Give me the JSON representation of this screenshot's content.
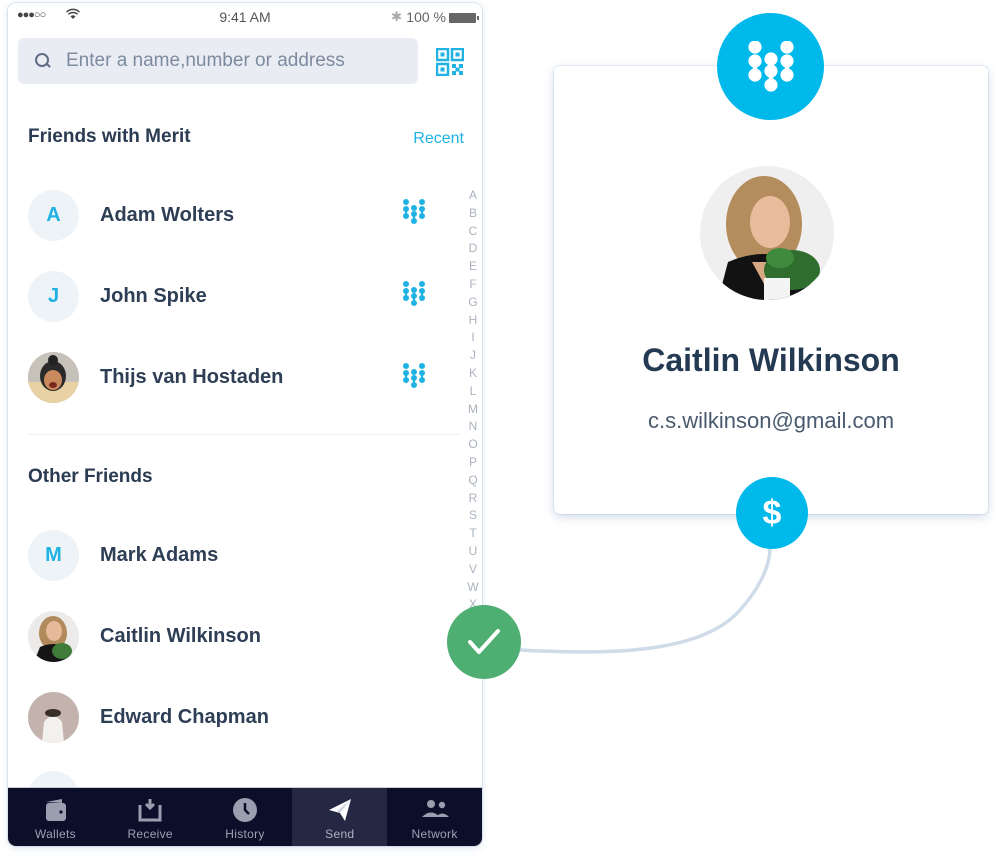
{
  "status_bar": {
    "signal": "●●●○○",
    "time": "9:41 AM",
    "bluetooth": "✱",
    "battery_percent": "100 %"
  },
  "search": {
    "placeholder": "Enter a name,number or address",
    "value": ""
  },
  "icons": {
    "search": "search-icon",
    "qr": "qr-code-icon",
    "merit": "merit-logo-icon",
    "dollar": "dollar-icon",
    "check": "checkmark-icon"
  },
  "sections": {
    "merit_friends": {
      "title": "Friends with Merit",
      "action": "Recent",
      "contacts": [
        {
          "name": "Adam Wolters",
          "initial": "A",
          "avatar": "initial"
        },
        {
          "name": "John Spike",
          "initial": "J",
          "avatar": "initial"
        },
        {
          "name": "Thijs van Hostaden",
          "initial": "",
          "avatar": "photo"
        }
      ]
    },
    "other_friends": {
      "title": "Other Friends",
      "contacts": [
        {
          "name": "Mark Adams",
          "initial": "M",
          "avatar": "initial"
        },
        {
          "name": "Caitlin Wilkinson",
          "initial": "",
          "avatar": "photo"
        },
        {
          "name": "Edward Chapman",
          "initial": "",
          "avatar": "photo"
        }
      ]
    }
  },
  "index_letters": [
    "A",
    "B",
    "C",
    "D",
    "E",
    "F",
    "G",
    "H",
    "I",
    "J",
    "K",
    "L",
    "M",
    "N",
    "O",
    "P",
    "Q",
    "R",
    "S",
    "T",
    "U",
    "V",
    "W",
    "X"
  ],
  "tabbar": {
    "active": "Send",
    "tabs": [
      {
        "label": "Wallets",
        "icon": "wallet-icon"
      },
      {
        "label": "Receive",
        "icon": "receive-icon"
      },
      {
        "label": "History",
        "icon": "history-clock-icon"
      },
      {
        "label": "Send",
        "icon": "send-paper-plane-icon"
      },
      {
        "label": "Network",
        "icon": "network-people-icon"
      }
    ]
  },
  "profile_card": {
    "name": "Caitlin Wilkinson",
    "email": "c.s.wilkinson@gmail.com",
    "action_symbol": "$"
  },
  "colors": {
    "accent": "#00b9eb",
    "success": "#4fae71",
    "tabbar_bg": "#0c0f29",
    "tabbar_active": "#252842",
    "text_primary": "#2a3b52",
    "connector": "#cfdbe8"
  }
}
